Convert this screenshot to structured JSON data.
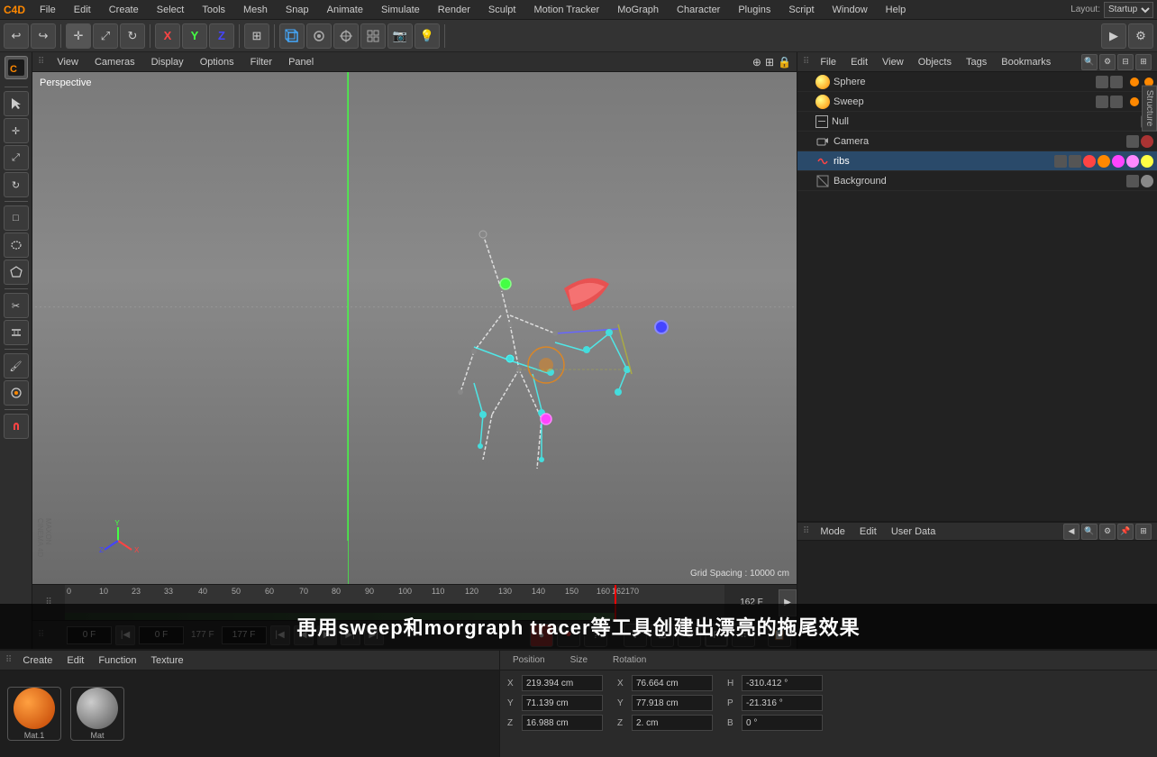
{
  "app": {
    "title": "Cinema 4D"
  },
  "menu_bar": {
    "items": [
      "File",
      "Edit",
      "Create",
      "Select",
      "Tools",
      "Mesh",
      "Snap",
      "Animate",
      "Simulate",
      "Render",
      "Sculpt",
      "Motion Tracker",
      "MoGraph",
      "Character",
      "Plugins",
      "Script",
      "Window",
      "Help"
    ]
  },
  "layout": {
    "label": "Layout:",
    "value": "Startup"
  },
  "viewport": {
    "perspective_label": "Perspective",
    "grid_spacing_label": "Grid Spacing : 10000 cm",
    "top_menu": [
      "View",
      "Cameras",
      "Display",
      "Options",
      "Filter",
      "Panel"
    ]
  },
  "objects_panel": {
    "menus": [
      "File",
      "Edit",
      "View",
      "Objects",
      "Tags",
      "Bookmarks"
    ],
    "items": [
      {
        "name": "Sphere",
        "icon_color": "#f80",
        "indent": 0,
        "tags": []
      },
      {
        "name": "Sweep",
        "icon_color": "#f80",
        "indent": 0,
        "tags": []
      },
      {
        "name": "Null",
        "icon_color": "#aaa",
        "indent": 1,
        "tags": []
      },
      {
        "name": "Camera",
        "icon_color": "#888",
        "indent": 0,
        "tags": []
      },
      {
        "name": "ribs",
        "icon_color": "#f44",
        "indent": 0,
        "tags": [
          "red",
          "orange",
          "pink",
          "pink2",
          "yellow"
        ]
      },
      {
        "name": "Background",
        "icon_color": "#888",
        "indent": 0,
        "tags": []
      }
    ]
  },
  "attributes_panel": {
    "menus": [
      "Mode",
      "Edit",
      "User Data"
    ]
  },
  "material_panel": {
    "menus": [
      "Create",
      "Edit",
      "Function",
      "Texture"
    ],
    "materials": [
      {
        "name": "Mat.1",
        "color": "#f80"
      },
      {
        "name": "Mat",
        "color": "#888"
      }
    ]
  },
  "coord_panel": {
    "sections": [
      "Position",
      "Size",
      "Rotation"
    ],
    "position": {
      "x": "219.394 cm",
      "y": "71.139 cm",
      "z": "16.988 cm"
    },
    "size": {
      "x": "76.664 cm",
      "y": "77.918 cm",
      "z": "2.cm"
    },
    "rotation": {
      "h": "-310.412 °",
      "p": "-21.316 °",
      "b": ""
    }
  },
  "timeline": {
    "start": "0",
    "end": "162 F",
    "ticks": [
      "0",
      "10",
      "23",
      "33",
      "40",
      "50",
      "60",
      "70",
      "80",
      "90",
      "100",
      "110",
      "120",
      "130",
      "140",
      "150",
      "160",
      "162170"
    ],
    "current_frame": "162",
    "playhead_pos": "162"
  },
  "transport": {
    "current_frame_input": "0 F",
    "start_frame": "0 F",
    "end_frame": "177 F",
    "end_frame2": "177 F"
  },
  "subtitle": {
    "text": "再用sweep和morgraph tracer等工具创建出漂亮的拖尾效果"
  },
  "icons": {
    "undo": "↩",
    "redo": "↪",
    "move": "✛",
    "scale": "⤢",
    "rotate": "↻",
    "x_axis": "X",
    "y_axis": "Y",
    "z_axis": "Z",
    "play": "▶",
    "pause": "⏸",
    "stop": "■",
    "next": "⏭",
    "prev": "⏮",
    "record": "●",
    "gear": "⚙",
    "search": "🔍"
  }
}
